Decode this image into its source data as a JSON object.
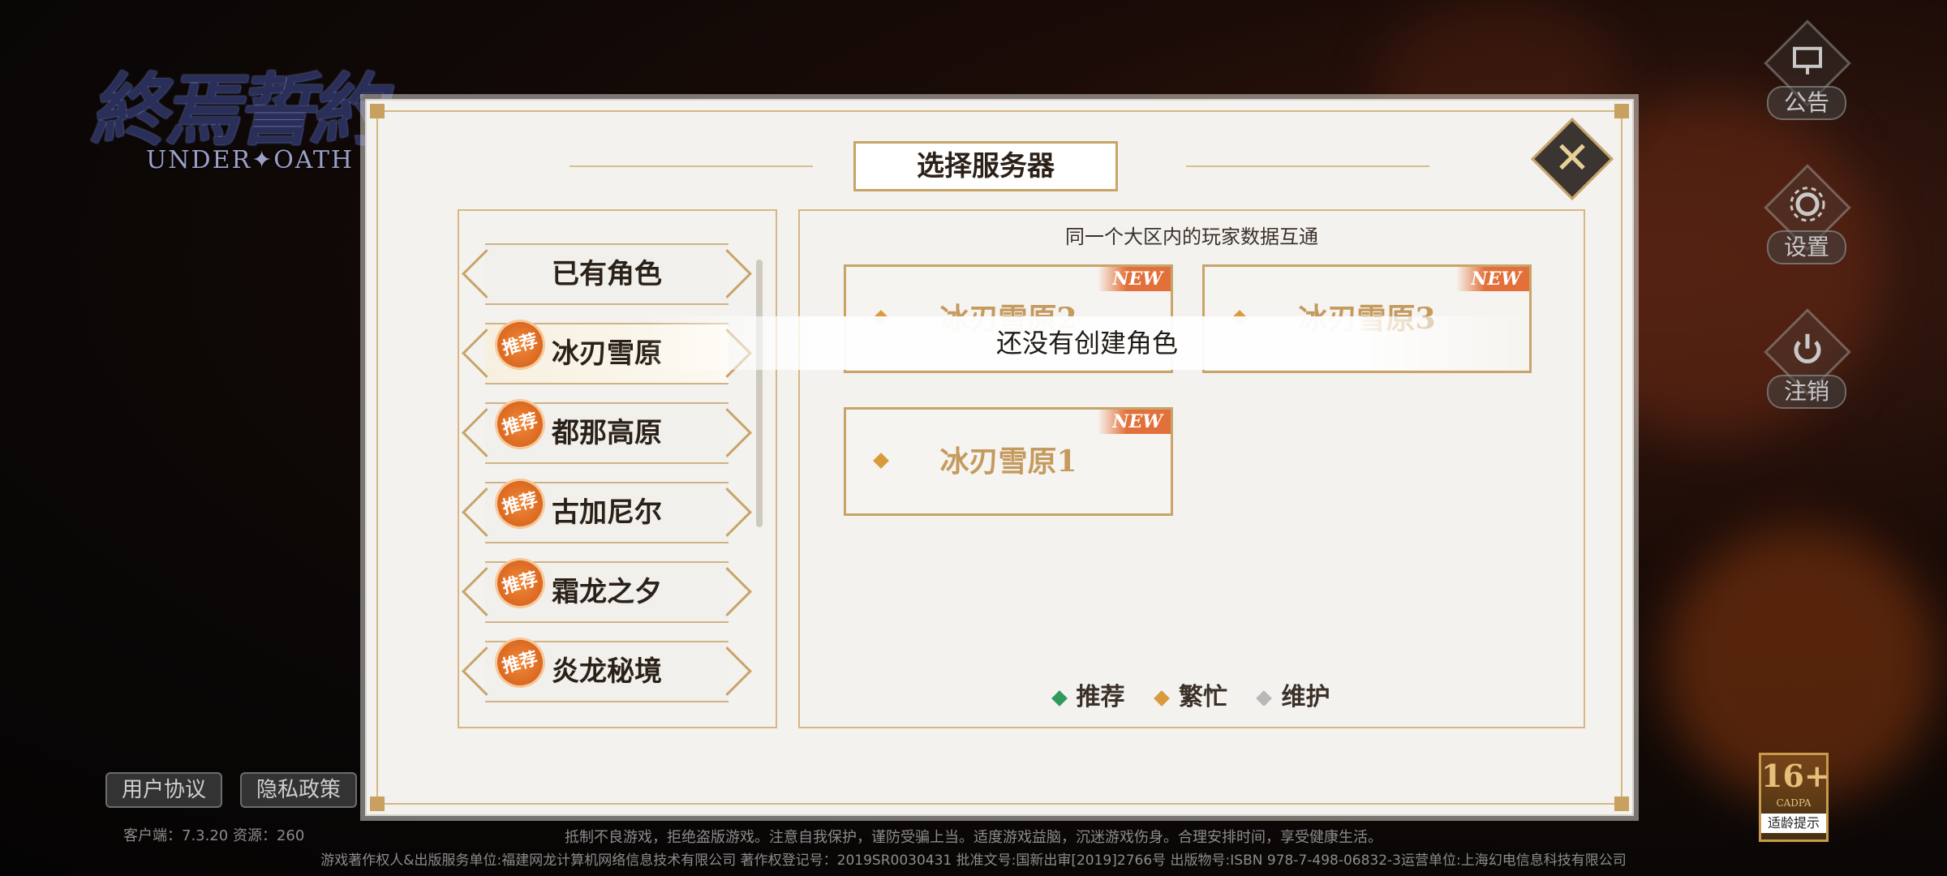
{
  "logo": {
    "title": "終焉誓約",
    "subtitle": "UNDER✦OATH"
  },
  "side_buttons": [
    {
      "label": "公告",
      "icon": "notice-icon"
    },
    {
      "label": "设置",
      "icon": "gear-icon"
    },
    {
      "label": "注销",
      "icon": "power-icon"
    }
  ],
  "dialog": {
    "title": "选择服务器",
    "close_icon": "close-icon"
  },
  "left_list": {
    "items": [
      {
        "label": "已有角色",
        "badge": ""
      },
      {
        "label": "冰刃雪原",
        "badge": "推荐"
      },
      {
        "label": "都那高原",
        "badge": "推荐"
      },
      {
        "label": "古加尼尔",
        "badge": "推荐"
      },
      {
        "label": "霜龙之夕",
        "badge": "推荐"
      },
      {
        "label": "炎龙秘境",
        "badge": "推荐"
      }
    ]
  },
  "right_panel": {
    "info": "同一个大区内的玩家数据互通",
    "servers": [
      {
        "name": "冰刃雪原2",
        "tag": "NEW"
      },
      {
        "name": "冰刃雪原3",
        "tag": "NEW"
      },
      {
        "name": "冰刃雪原1",
        "tag": "NEW"
      }
    ],
    "legend": [
      {
        "label": "推荐",
        "color": "#2f9a5c"
      },
      {
        "label": "繁忙",
        "color": "#d99a3c"
      },
      {
        "label": "维护",
        "color": "#b8b8b8"
      }
    ]
  },
  "toast": "还没有创建角色",
  "footer": {
    "user_agreement": "用户协议",
    "privacy_policy": "隐私政策",
    "version": "客户端：7.3.20  资源：260",
    "notice_line1": "抵制不良游戏，拒绝盗版游戏。注意自我保护，谨防受骗上当。适度游戏益脑，沉迷游戏伤身。合理安排时间，享受健康生活。",
    "notice_line2": "游戏著作权人&出版服务单位:福建网龙计算机网络信息技术有限公司  著作权登记号：2019SR0030431  批准文号:国新出审[2019]2766号  出版物号:ISBN 978-7-498-06832-3运营单位:上海幻电信息科技有限公司",
    "age_rating": "16+",
    "age_sub": "CADPA",
    "age_label": "适龄提示"
  }
}
